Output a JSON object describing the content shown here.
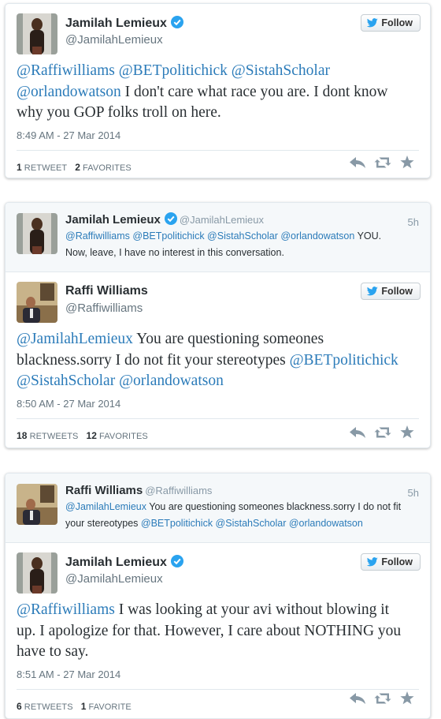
{
  "ui": {
    "follow_label": "Follow"
  },
  "tweet1": {
    "name": "Jamilah Lemieux",
    "handle": "@JamilahLemieux",
    "text_mentions": "@Raffiwilliams @BETpolitichick @SistahScholar @orlandowatson",
    "text_body": " I don't care what race you are. I dont know why you GOP folks troll on here.",
    "timestamp": "8:49 AM - 27 Mar 2014",
    "retweets_count": "1",
    "retweets_label": "RETWEET",
    "favorites_count": "2",
    "favorites_label": "FAVORITES"
  },
  "tweet2": {
    "parent": {
      "name": "Jamilah Lemieux",
      "handle": "@JamilahLemieux",
      "time": "5h",
      "text_mentions": "@Raffiwilliams @BETpolitichick @SistahScholar @orlandowatson",
      "text_body_1": " YOU.",
      "text_body_2": "Now, leave, I have no interest in this conversation."
    },
    "name": "Raffi Williams",
    "handle": "@Raffiwilliams",
    "text_mention_1": "@JamilahLemieux",
    "text_body": "  You are questioning someones blackness.sorry I do not fit your stereotypes ",
    "text_mentions_2": "@BETpolitichick @SistahScholar @orlandowatson",
    "timestamp": "8:50 AM - 27 Mar 2014",
    "retweets_count": "18",
    "retweets_label": "RETWEETS",
    "favorites_count": "12",
    "favorites_label": "FAVORITES"
  },
  "tweet3": {
    "parent": {
      "name": "Raffi Williams",
      "handle": "@Raffiwilliams",
      "time": "5h",
      "text_mention_1": "@JamilahLemieux",
      "text_body": "  You are questioning someones blackness.sorry I do not fit your stereotypes ",
      "text_mentions_2": "@BETpolitichick @SistahScholar @orlandowatson"
    },
    "name": "Jamilah Lemieux",
    "handle": "@JamilahLemieux",
    "text_mention_1": "@Raffiwilliams",
    "text_body": "  I was looking at your avi without blowing it up. I apologize for that. However, I care about NOTHING you have to say.",
    "timestamp": "8:51 AM - 27 Mar 2014",
    "retweets_count": "6",
    "retweets_label": "RETWEETS",
    "favorites_count": "1",
    "favorites_label": "FAVORITE"
  },
  "icons": [
    "verified-badge-icon",
    "twitter-bird-icon",
    "reply-icon",
    "retweet-icon",
    "favorite-star-icon"
  ],
  "colors": {
    "link": "#2b7bb9",
    "verified": "#2aa3ef",
    "icon_gray": "#8899a6"
  }
}
